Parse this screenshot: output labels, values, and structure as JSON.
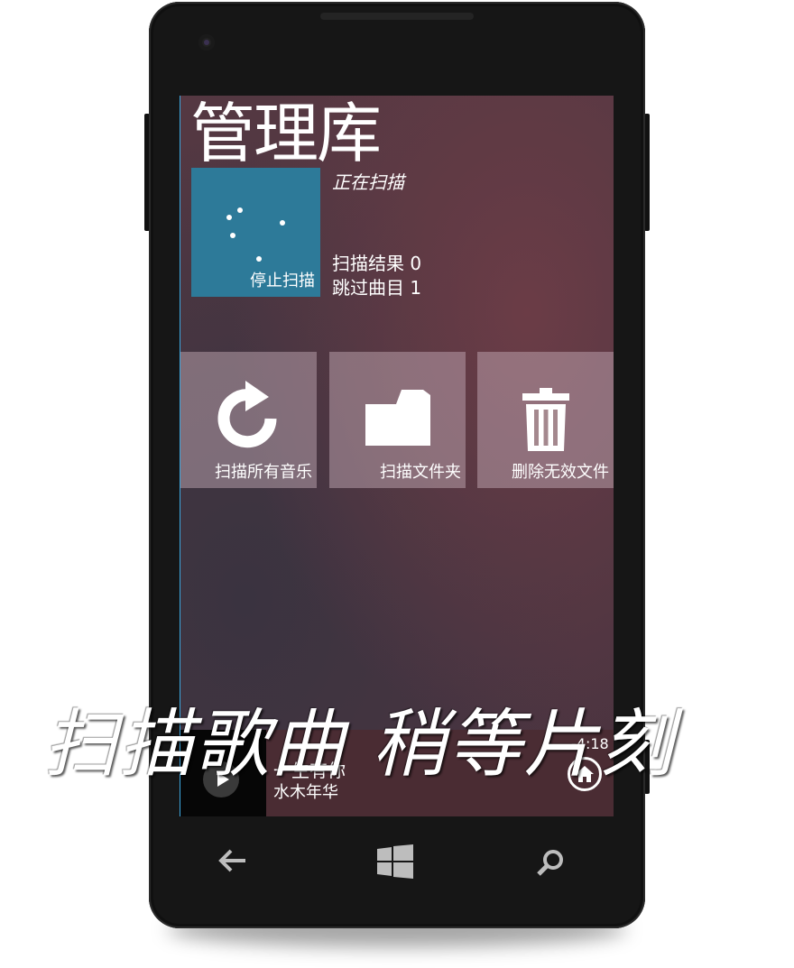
{
  "page": {
    "title": "管理库"
  },
  "scan": {
    "button_label": "停止扫描",
    "status": "正在扫描",
    "results_label": "扫描结果",
    "results_count": "0",
    "skipped_label": "跳过曲目",
    "skipped_count": "1"
  },
  "tiles": [
    {
      "label": "扫描所有音乐",
      "icon": "refresh-icon"
    },
    {
      "label": "扫描文件夹",
      "icon": "folder-icon"
    },
    {
      "label": "删除无效文件",
      "icon": "trash-icon"
    }
  ],
  "now_playing": {
    "title": "一生有你",
    "artist": "水木年华",
    "time_remaining": "-4:18",
    "play_icon": "play-icon",
    "home_icon": "home-icon"
  },
  "nav_bar": {
    "back_icon": "back-arrow-icon",
    "start_icon": "windows-logo-icon",
    "search_icon": "search-icon"
  },
  "overlay_caption": "扫描歌曲 稍等片刻",
  "colors": {
    "accent_tile": "#2d7a99",
    "screen_edge": "#3da7e0"
  }
}
